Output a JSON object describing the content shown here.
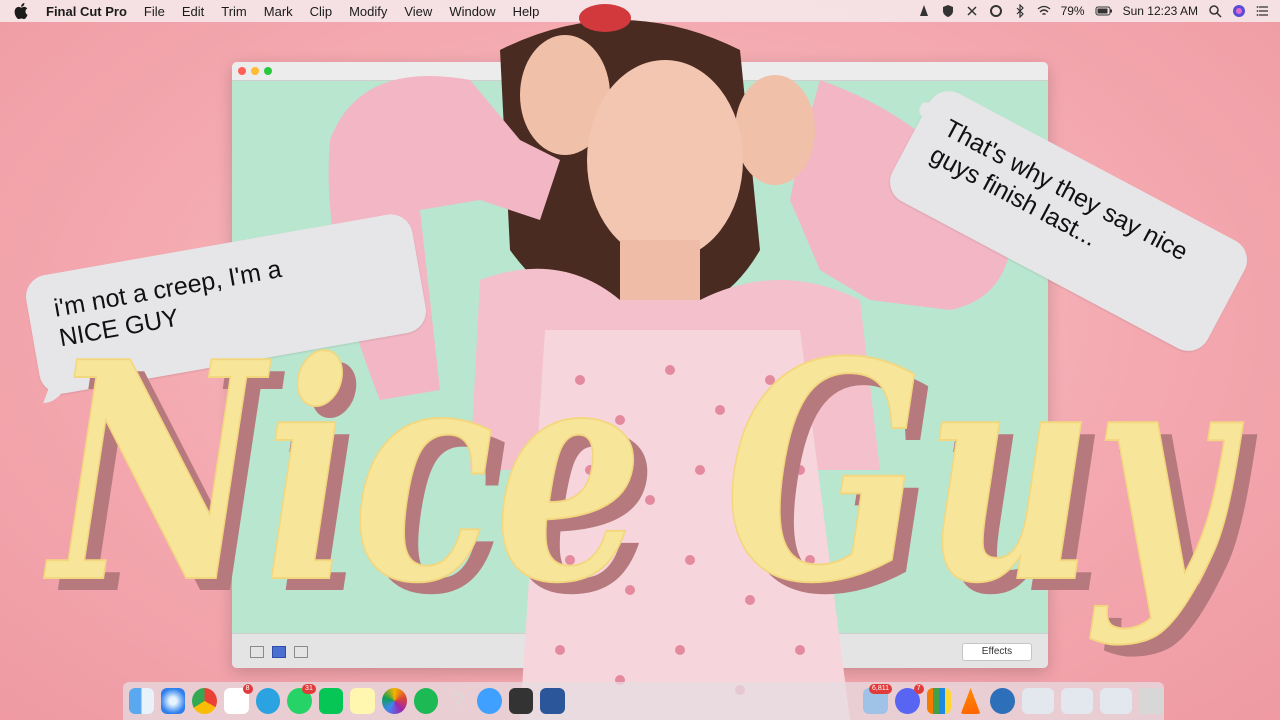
{
  "menubar": {
    "app_name": "Final Cut Pro",
    "items": [
      "File",
      "Edit",
      "Trim",
      "Mark",
      "Clip",
      "Modify",
      "View",
      "Window",
      "Help"
    ],
    "battery": "79%",
    "clock": "Sun 12:23 AM"
  },
  "window": {
    "effects_button": "Effects"
  },
  "bubbles": {
    "left_text_line1": "i'm not a creep, I'm a",
    "left_text_line2": "NICE GUY",
    "right_text_line1": "That's why they say nice",
    "right_text_line2": "guys finish last..."
  },
  "title": {
    "text": "Nice Guy",
    "fill_color": "#f7e59a",
    "shadow_color": "#b67a7e"
  },
  "dock": {
    "apps": [
      "finder-icon",
      "safari-icon",
      "chrome-icon",
      "reminders-icon",
      "telegram-icon",
      "whatsapp-icon",
      "line-icon",
      "notes-icon",
      "photos-icon",
      "spotify-icon",
      "help-icon",
      "messages-icon",
      "imovie-icon",
      "word-icon",
      "preview-icon",
      "discord-icon",
      "keynote-icon",
      "vlc-icon",
      "quicktime-icon",
      "window-thumb-1",
      "window-thumb-2",
      "window-thumb-3",
      "trash-icon"
    ],
    "badges": {
      "reminders": "8",
      "whatsapp": "31",
      "preview": "6,811",
      "discord": "7"
    }
  }
}
